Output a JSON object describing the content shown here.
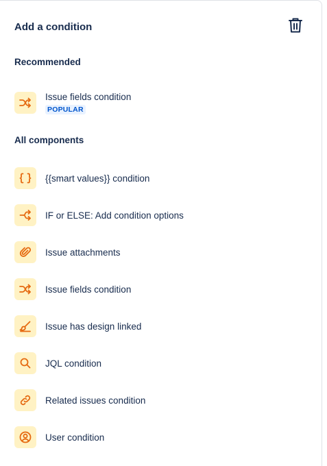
{
  "header": {
    "title": "Add a condition",
    "delete_icon": "trash-icon"
  },
  "recommended": {
    "heading": "Recommended",
    "items": [
      {
        "label": "Issue fields condition",
        "badge": "POPULAR",
        "icon": "shuffle-icon"
      }
    ]
  },
  "all_components": {
    "heading": "All components",
    "items": [
      {
        "label": "{{smart values}} condition",
        "icon": "braces-icon"
      },
      {
        "label": "IF or ELSE: Add condition options",
        "icon": "branch-icon"
      },
      {
        "label": "Issue attachments",
        "icon": "paperclip-icon"
      },
      {
        "label": "Issue fields condition",
        "icon": "shuffle-icon"
      },
      {
        "label": "Issue has design linked",
        "icon": "design-pen-icon"
      },
      {
        "label": "JQL condition",
        "icon": "search-icon"
      },
      {
        "label": "Related issues condition",
        "icon": "link-icon"
      },
      {
        "label": "User condition",
        "icon": "user-icon"
      }
    ]
  },
  "colors": {
    "icon_bg": "#fff2c4",
    "icon_fg": "#e56910",
    "badge_bg": "#e9f2ff",
    "badge_fg": "#0055cc",
    "text": "#172b4d"
  }
}
